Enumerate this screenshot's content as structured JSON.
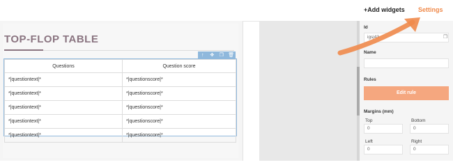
{
  "header": {
    "add_widgets": "+Add widgets",
    "settings": "Settings"
  },
  "canvas": {
    "title": "TOP-FLOP TABLE",
    "table": {
      "columns": [
        "Questions",
        "Question score"
      ],
      "rows": [
        [
          "*|questiontext|*",
          "*|questionscore|*"
        ],
        [
          "*|questiontext|*",
          "*|questionscore|*"
        ],
        [
          "*|questiontext|*",
          "*|questionscore|*"
        ],
        [
          "*|questiontext|*",
          "*|questionscore|*"
        ],
        [
          "*|questiontext|*",
          "*|questionscore|*"
        ]
      ]
    }
  },
  "panel": {
    "id_label": "Id",
    "id_value": "igsj43",
    "name_label": "Name",
    "rules_label": "Rules",
    "edit_rule": "Edit rule",
    "margins_label": "Margins (mm)",
    "top_label": "Top",
    "top_value": "0",
    "bottom_label": "Bottom",
    "bottom_value": "0",
    "left_label": "Left",
    "left_value": "0",
    "right_label": "Right",
    "right_value": "0"
  },
  "colors": {
    "accent": "#f08a4b",
    "button": "#f5a77f",
    "selection": "#8fb8dc",
    "title": "#8a7480"
  },
  "icons": [
    "arrow-up-icon",
    "move-icon",
    "copy-icon",
    "trash-icon",
    "copy-id-icon",
    "annotation-arrow"
  ]
}
